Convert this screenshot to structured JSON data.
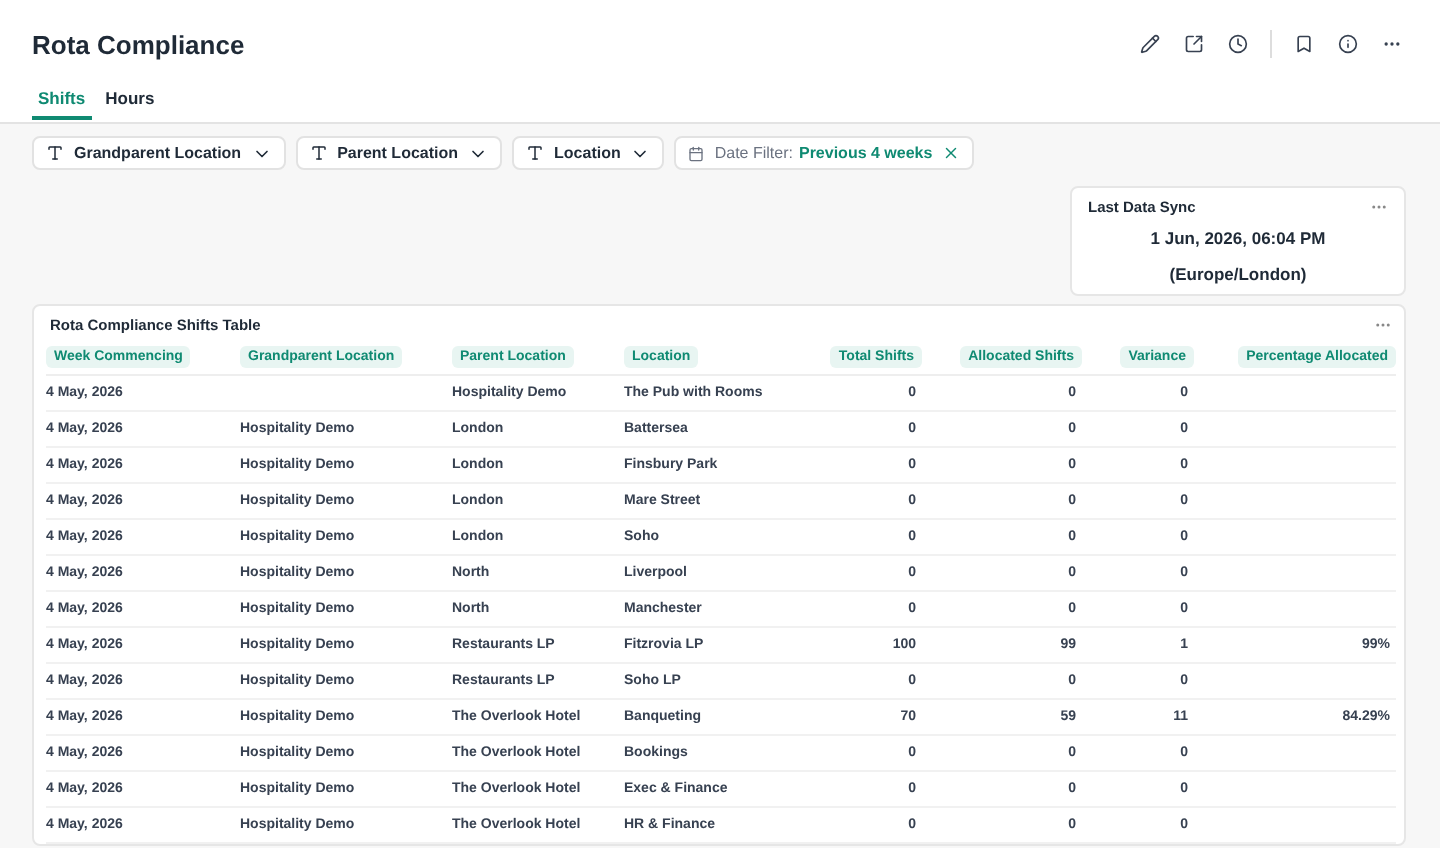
{
  "page": {
    "title": "Rota Compliance"
  },
  "tabs": [
    {
      "label": "Shifts",
      "selected": true
    },
    {
      "label": "Hours",
      "selected": false
    }
  ],
  "filters": [
    {
      "kind": "text",
      "label": "Grandparent Location"
    },
    {
      "kind": "text",
      "label": "Parent Location"
    },
    {
      "kind": "text",
      "label": "Location"
    },
    {
      "kind": "date",
      "label": "Date Filter:",
      "value": "Previous 4 weeks"
    }
  ],
  "sync_card": {
    "title": "Last Data Sync",
    "datetime": "1 Jun, 2026, 06:04 PM",
    "timezone": "(Europe/London)"
  },
  "table": {
    "title": "Rota Compliance Shifts Table",
    "columns": [
      {
        "label": "Week Commencing",
        "kind": "text"
      },
      {
        "label": "Grandparent Location",
        "kind": "text"
      },
      {
        "label": "Parent Location",
        "kind": "text"
      },
      {
        "label": "Location",
        "kind": "text"
      },
      {
        "label": "Total Shifts",
        "kind": "number"
      },
      {
        "label": "Allocated Shifts",
        "kind": "number"
      },
      {
        "label": "Variance",
        "kind": "number"
      },
      {
        "label": "Percentage Allocated",
        "kind": "number"
      }
    ],
    "rows": [
      [
        "4 May, 2026",
        "",
        "Hospitality Demo",
        "The Pub with Rooms",
        "0",
        "0",
        "0",
        ""
      ],
      [
        "4 May, 2026",
        "Hospitality Demo",
        "London",
        "Battersea",
        "0",
        "0",
        "0",
        ""
      ],
      [
        "4 May, 2026",
        "Hospitality Demo",
        "London",
        "Finsbury Park",
        "0",
        "0",
        "0",
        ""
      ],
      [
        "4 May, 2026",
        "Hospitality Demo",
        "London",
        "Mare Street",
        "0",
        "0",
        "0",
        ""
      ],
      [
        "4 May, 2026",
        "Hospitality Demo",
        "London",
        "Soho",
        "0",
        "0",
        "0",
        ""
      ],
      [
        "4 May, 2026",
        "Hospitality Demo",
        "North",
        "Liverpool",
        "0",
        "0",
        "0",
        ""
      ],
      [
        "4 May, 2026",
        "Hospitality Demo",
        "North",
        "Manchester",
        "0",
        "0",
        "0",
        ""
      ],
      [
        "4 May, 2026",
        "Hospitality Demo",
        "Restaurants LP",
        "Fitzrovia LP",
        "100",
        "99",
        "1",
        "99%"
      ],
      [
        "4 May, 2026",
        "Hospitality Demo",
        "Restaurants LP",
        "Soho LP",
        "0",
        "0",
        "0",
        ""
      ],
      [
        "4 May, 2026",
        "Hospitality Demo",
        "The Overlook Hotel",
        "Banqueting",
        "70",
        "59",
        "11",
        "84.29%"
      ],
      [
        "4 May, 2026",
        "Hospitality Demo",
        "The Overlook Hotel",
        "Bookings",
        "0",
        "0",
        "0",
        ""
      ],
      [
        "4 May, 2026",
        "Hospitality Demo",
        "The Overlook Hotel",
        "Exec & Finance",
        "0",
        "0",
        "0",
        ""
      ],
      [
        "4 May, 2026",
        "Hospitality Demo",
        "The Overlook Hotel",
        "HR & Finance",
        "0",
        "0",
        "0",
        ""
      ]
    ]
  }
}
